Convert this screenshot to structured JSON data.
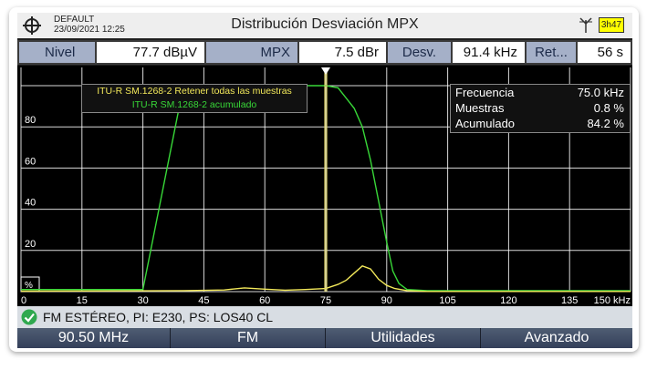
{
  "header": {
    "preset": "DEFAULT",
    "datetime": "23/09/2021 12:25",
    "title": "Distribución Desviación MPX",
    "battery": "3h47",
    "icons": [
      "crosshair-logo-icon",
      "antenna-icon",
      "battery-icon"
    ]
  },
  "measurements": {
    "nivel_label": "Nivel",
    "nivel_value": "77.7 dBµV",
    "mpx_label": "MPX",
    "mpx_value": "7.5 dBr",
    "desv_label": "Desv.",
    "desv_value": "91.4 kHz",
    "ret_label": "Ret...",
    "ret_value": "56 s"
  },
  "legend": {
    "hold": "ITU-R SM.1268-2 Retener todas las muestras",
    "accum": "ITU-R SM.1268-2 acumulado"
  },
  "info": {
    "freq_label": "Frecuencia",
    "freq_value": "75.0 kHz",
    "samples_label": "Muestras",
    "samples_value": "0.8 %",
    "accum_label": "Acumulado",
    "accum_value": "84.2 %"
  },
  "status": {
    "text": "FM ESTÉREO, PI: E230, PS: LOS40 CL",
    "icon": "check-icon"
  },
  "softkeys": [
    "90.50 MHz",
    "FM",
    "Utilidades",
    "Avanzado"
  ],
  "colors": {
    "hold_series": "#f2e85a",
    "accum_series": "#38d838",
    "marker": "#d9cf63",
    "grid": "#ffffff",
    "label_bg": "#a5b0c8",
    "softkey_bg": "#3e4a63"
  },
  "chart_data": {
    "type": "line",
    "xlabel": "",
    "ylabel": "",
    "y_unit_label": "%",
    "x_unit": "kHz",
    "x_ticks": [
      "0",
      "15",
      "30",
      "45",
      "60",
      "75",
      "90",
      "105",
      "120",
      "135",
      "150 kHz"
    ],
    "y_ticks": [
      "80",
      "60",
      "40",
      "20"
    ],
    "xlim": [
      0,
      150
    ],
    "ylim": [
      0,
      100
    ],
    "grid": true,
    "marker_x": 75.0,
    "series": [
      {
        "name": "ITU-R SM.1268-2 acumulado",
        "points": [
          [
            0,
            1
          ],
          [
            30,
            1
          ],
          [
            40,
            100
          ],
          [
            75,
            100
          ],
          [
            78,
            99
          ],
          [
            80,
            94
          ],
          [
            82,
            89
          ],
          [
            84,
            80
          ],
          [
            86,
            64
          ],
          [
            88,
            44
          ],
          [
            90,
            24
          ],
          [
            91.5,
            10
          ],
          [
            93,
            4
          ],
          [
            95,
            1
          ],
          [
            100,
            0.5
          ],
          [
            150,
            0.5
          ]
        ]
      },
      {
        "name": "ITU-R SM.1268-2 Retener todas las muestras",
        "points": [
          [
            0,
            0.2
          ],
          [
            40,
            0.5
          ],
          [
            50,
            0.8
          ],
          [
            55,
            1.8
          ],
          [
            60,
            1.2
          ],
          [
            65,
            0.7
          ],
          [
            70,
            1.0
          ],
          [
            75,
            1.5
          ],
          [
            78,
            3.5
          ],
          [
            80,
            5.5
          ],
          [
            82,
            9
          ],
          [
            84,
            12.5
          ],
          [
            86,
            11
          ],
          [
            88,
            6
          ],
          [
            90,
            3
          ],
          [
            92,
            1.5
          ],
          [
            95,
            0.5
          ],
          [
            100,
            0.1
          ],
          [
            150,
            0.1
          ]
        ]
      }
    ]
  }
}
